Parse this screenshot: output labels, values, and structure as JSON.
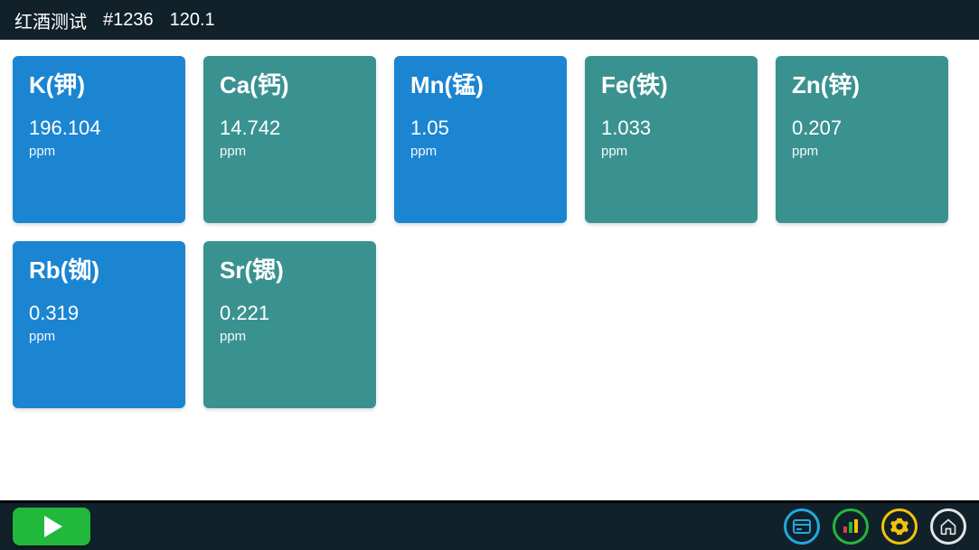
{
  "header": {
    "title": "红酒测试",
    "id": "#1236",
    "value": "120.1"
  },
  "colors": {
    "blue": "#1C85D1",
    "teal": "#3A9290",
    "play": "#22B83C",
    "icon_card": "#1FAAE0",
    "icon_gear": "#F3C20C",
    "icon_home": "#E4E4E4"
  },
  "elements": [
    {
      "name": "K(钾)",
      "value": "196.104",
      "unit": "ppm",
      "color": "blue"
    },
    {
      "name": "Ca(钙)",
      "value": "14.742",
      "unit": "ppm",
      "color": "teal"
    },
    {
      "name": "Mn(锰)",
      "value": "1.05",
      "unit": "ppm",
      "color": "blue"
    },
    {
      "name": "Fe(铁)",
      "value": "1.033",
      "unit": "ppm",
      "color": "teal"
    },
    {
      "name": "Zn(锌)",
      "value": "0.207",
      "unit": "ppm",
      "color": "teal"
    },
    {
      "name": "Rb(铷)",
      "value": "0.319",
      "unit": "ppm",
      "color": "blue"
    },
    {
      "name": "Sr(锶)",
      "value": "0.221",
      "unit": "ppm",
      "color": "teal"
    }
  ]
}
